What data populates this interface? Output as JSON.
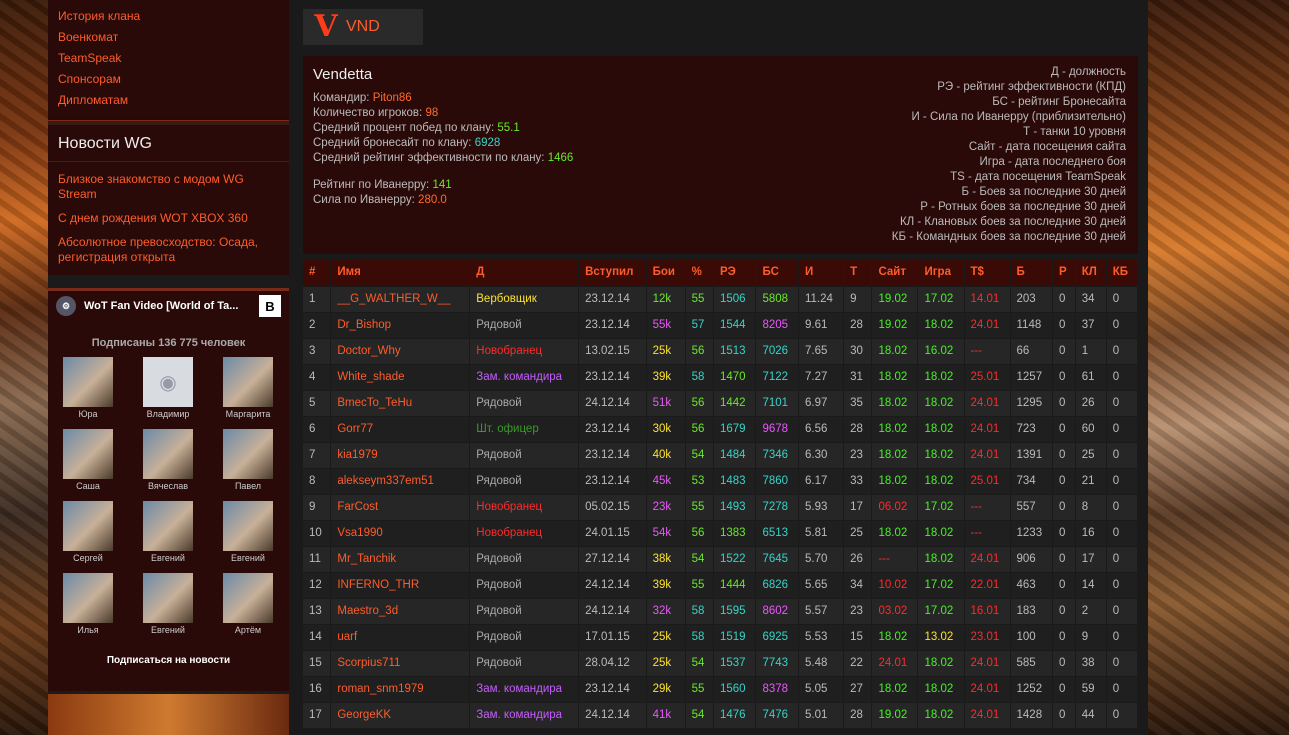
{
  "sidebar": {
    "menu": [
      "История клана",
      "Военкомат",
      "TeamSpeak",
      "Спонсорам",
      "Дипломатам"
    ],
    "news_title": "Новости WG",
    "news": [
      "Близкое знакомство с модом WG Stream",
      "С днем рождения WOT XBOX 360",
      "Абсолютное превосходство: Осада, регистрация открыта"
    ],
    "vk": {
      "title": "WoT Fan Video [World of Ta...",
      "badge": "B",
      "subscribers": "Подписаны 136 775 человек",
      "users": [
        "Юра",
        "Владимир",
        "Маргарита",
        "Саша",
        "Вячеслав",
        "Павел",
        "Сергей",
        "Евгений",
        "Евгений",
        "Илья",
        "Евгений",
        "Артём"
      ],
      "follow": "Подписаться на новости"
    }
  },
  "clan": {
    "tag": "VND",
    "logo_letter": "V",
    "name": "Vendetta",
    "commander_label": "Командир:",
    "commander": "Piton86",
    "players_label": "Количество игроков:",
    "players": "98",
    "winrate_label": "Средний процент побед по клану:",
    "winrate": "55.1",
    "bs_label": "Средний бронесайт по клану:",
    "bs": "6928",
    "eff_label": "Средний рейтинг эффективности по клану:",
    "eff": "1466",
    "ivan_rating_label": "Рейтинг по Иванерру:",
    "ivan_rating": "141",
    "ivan_power_label": "Сила по Иванерру:",
    "ivan_power": "280.0"
  },
  "legend": [
    "Д - должность",
    "РЭ - рейтинг эффективности (КПД)",
    "БС - рейтинг Бронесайта",
    "И - Сила по Иванерру (приблизительно)",
    "Т - танки 10 уровня",
    "Сайт - дата посещения сайта",
    "Игра - дата последнего боя",
    "TS - дата посещения TeamSpeak",
    "Б - Боев за последние 30 дней",
    "Р - Ротных боев за последние 30 дней",
    "КЛ - Клановых боев за последние 30 дней",
    "КБ - Командных боев за последние 30 дней"
  ],
  "table": {
    "headers": [
      "#",
      "Имя",
      "Д",
      "Вступил",
      "Бои",
      "%",
      "РЭ",
      "БС",
      "И",
      "Т",
      "Сайт",
      "Игра",
      "T$",
      "Б",
      "Р",
      "КЛ",
      "КБ"
    ],
    "rows": [
      [
        "1",
        "__G_WALTHER_W__",
        "Вербовщик",
        "23.12.14",
        "12k",
        "55",
        "1506",
        "5808",
        "11.24",
        "9",
        "19.02",
        "17.02",
        "14.01",
        "203",
        "0",
        "34",
        "0"
      ],
      [
        "2",
        "Dr_Bishop",
        "Рядовой",
        "23.12.14",
        "55k",
        "57",
        "1544",
        "8205",
        "9.61",
        "28",
        "19.02",
        "18.02",
        "24.01",
        "1148",
        "0",
        "37",
        "0"
      ],
      [
        "3",
        "Doctor_Why",
        "Новобранец",
        "13.02.15",
        "25k",
        "56",
        "1513",
        "7026",
        "7.65",
        "30",
        "18.02",
        "16.02",
        "---",
        "66",
        "0",
        "1",
        "0"
      ],
      [
        "4",
        "White_shade",
        "Зам. командира",
        "23.12.14",
        "39k",
        "58",
        "1470",
        "7122",
        "7.27",
        "31",
        "18.02",
        "18.02",
        "25.01",
        "1257",
        "0",
        "61",
        "0"
      ],
      [
        "5",
        "BmecTo_TeHu",
        "Рядовой",
        "24.12.14",
        "51k",
        "56",
        "1442",
        "7101",
        "6.97",
        "35",
        "18.02",
        "18.02",
        "24.01",
        "1295",
        "0",
        "26",
        "0"
      ],
      [
        "6",
        "Gorr77",
        "Шт. офицер",
        "23.12.14",
        "30k",
        "56",
        "1679",
        "9678",
        "6.56",
        "28",
        "18.02",
        "18.02",
        "24.01",
        "723",
        "0",
        "60",
        "0"
      ],
      [
        "7",
        "kia1979",
        "Рядовой",
        "23.12.14",
        "40k",
        "54",
        "1484",
        "7346",
        "6.30",
        "23",
        "18.02",
        "18.02",
        "24.01",
        "1391",
        "0",
        "25",
        "0"
      ],
      [
        "8",
        "alekseym337em51",
        "Рядовой",
        "23.12.14",
        "45k",
        "53",
        "1483",
        "7860",
        "6.17",
        "33",
        "18.02",
        "18.02",
        "25.01",
        "734",
        "0",
        "21",
        "0"
      ],
      [
        "9",
        "FarCost",
        "Новобранец",
        "05.02.15",
        "23k",
        "55",
        "1493",
        "7278",
        "5.93",
        "17",
        "06.02",
        "17.02",
        "---",
        "557",
        "0",
        "8",
        "0"
      ],
      [
        "10",
        "Vsa1990",
        "Новобранец",
        "24.01.15",
        "54k",
        "56",
        "1383",
        "6513",
        "5.81",
        "25",
        "18.02",
        "18.02",
        "---",
        "1233",
        "0",
        "16",
        "0"
      ],
      [
        "11",
        "Mr_Tanchik",
        "Рядовой",
        "27.12.14",
        "38k",
        "54",
        "1522",
        "7645",
        "5.70",
        "26",
        "---",
        "18.02",
        "24.01",
        "906",
        "0",
        "17",
        "0"
      ],
      [
        "12",
        "INFERNO_THR",
        "Рядовой",
        "24.12.14",
        "39k",
        "55",
        "1444",
        "6826",
        "5.65",
        "34",
        "10.02",
        "17.02",
        "22.01",
        "463",
        "0",
        "14",
        "0"
      ],
      [
        "13",
        "Maestro_3d",
        "Рядовой",
        "24.12.14",
        "32k",
        "58",
        "1595",
        "8602",
        "5.57",
        "23",
        "03.02",
        "17.02",
        "16.01",
        "183",
        "0",
        "2",
        "0"
      ],
      [
        "14",
        "uarf",
        "Рядовой",
        "17.01.15",
        "25k",
        "58",
        "1519",
        "6925",
        "5.53",
        "15",
        "18.02",
        "13.02",
        "23.01",
        "100",
        "0",
        "9",
        "0"
      ],
      [
        "15",
        "Scorpius711",
        "Рядовой",
        "28.04.12",
        "25k",
        "54",
        "1537",
        "7743",
        "5.48",
        "22",
        "24.01",
        "18.02",
        "24.01",
        "585",
        "0",
        "38",
        "0"
      ],
      [
        "16",
        "roman_snm1979",
        "Зам. командира",
        "23.12.14",
        "29k",
        "55",
        "1560",
        "8378",
        "5.05",
        "27",
        "18.02",
        "18.02",
        "24.01",
        "1252",
        "0",
        "59",
        "0"
      ],
      [
        "17",
        "GeorgeKK",
        "Зам. командира",
        "24.12.14",
        "41k",
        "54",
        "1476",
        "7476",
        "5.01",
        "28",
        "19.02",
        "18.02",
        "24.01",
        "1428",
        "0",
        "44",
        "0"
      ]
    ],
    "colors": {
      "role": [
        "c-yel",
        "c-grey",
        "c-red",
        "c-pur",
        "c-grey",
        "c-dgr",
        "c-grey",
        "c-grey",
        "c-red",
        "c-red",
        "c-grey",
        "c-grey",
        "c-grey",
        "c-grey",
        "c-grey",
        "c-pur",
        "c-pur"
      ],
      "battles": [
        "c-grn",
        "c-mag",
        "c-ylw2",
        "c-ylw2",
        "c-mag",
        "c-ylw2",
        "c-ylw2",
        "c-mag",
        "c-mag",
        "c-mag",
        "c-ylw2",
        "c-ylw2",
        "c-mag",
        "c-ylw2",
        "c-ylw2",
        "c-ylw2",
        "c-mag"
      ],
      "winrate": [
        "c-grn",
        "c-cy",
        "c-grn",
        "c-cy",
        "c-grn",
        "c-grn",
        "c-grn",
        "c-grn",
        "c-grn",
        "c-grn",
        "c-grn",
        "c-grn",
        "c-cy",
        "c-cy",
        "c-grn",
        "c-grn",
        "c-grn"
      ],
      "eff": [
        "c-cy",
        "c-cy",
        "c-cy",
        "c-grn",
        "c-grn",
        "c-cy",
        "c-cy",
        "c-cy",
        "c-cy",
        "c-grn",
        "c-cy",
        "c-grn",
        "c-cy",
        "c-cy",
        "c-cy",
        "c-cy",
        "c-cy"
      ],
      "bs": [
        "c-grn",
        "c-mag",
        "c-cy",
        "c-cy",
        "c-cy",
        "c-mag",
        "c-cy",
        "c-cy",
        "c-cy",
        "c-cy",
        "c-cy",
        "c-cy",
        "c-mag",
        "c-cy",
        "c-cy",
        "c-mag",
        "c-cy"
      ],
      "site": [
        "c-lime",
        "c-lime",
        "c-lime",
        "c-lime",
        "c-lime",
        "c-lime",
        "c-lime",
        "c-lime",
        "c-red",
        "c-lime",
        "c-red",
        "c-red",
        "c-red",
        "c-lime",
        "c-red",
        "c-lime",
        "c-lime"
      ],
      "game": [
        "c-lime",
        "c-lime",
        "c-lime",
        "c-lime",
        "c-lime",
        "c-lime",
        "c-lime",
        "c-lime",
        "c-lime",
        "c-lime",
        "c-lime",
        "c-lime",
        "c-lime",
        "c-yel",
        "c-lime",
        "c-lime",
        "c-lime"
      ]
    }
  }
}
